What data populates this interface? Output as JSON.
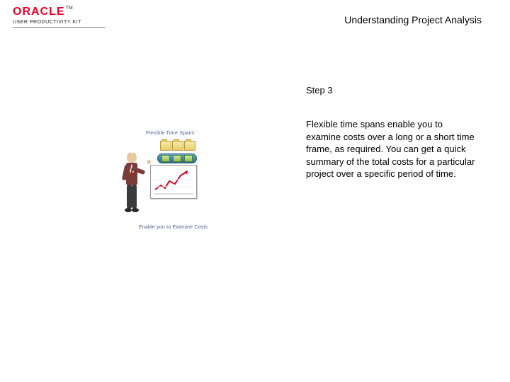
{
  "header": {
    "brand": "ORACLE",
    "tm": "TM",
    "product_line": "USER PRODUCTIVITY KIT",
    "page_title": "Understanding Project Analysis"
  },
  "illustration": {
    "caption_top": "Flexible Time Spans",
    "caption_bottom": "Enable you to Examine Costs"
  },
  "content": {
    "step_label": "Step 3",
    "body": "Flexible time spans enable you to examine costs over a long or a short time frame, as required. You can get a quick summary of the total costs for a particular project over a specific period of time."
  }
}
